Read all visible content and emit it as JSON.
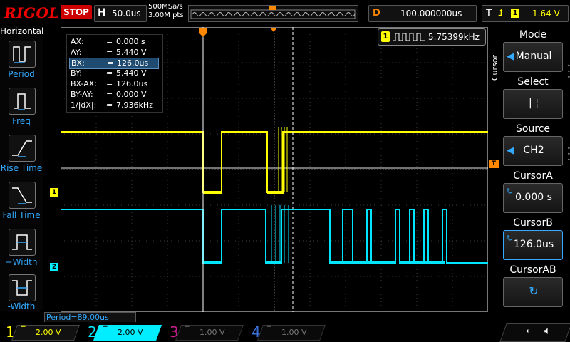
{
  "top": {
    "brand": "RIGOL",
    "run_state": "STOP",
    "h_key": "H",
    "h_value": "50.0us",
    "sample_rate": "500MSa/s",
    "mem_depth": "3.00M pts",
    "d_key": "D",
    "d_value": "100.000000us",
    "t_key": "T",
    "trig_channel": "1",
    "trig_level": "1.64 V"
  },
  "left_menu": {
    "title": "Horizontal",
    "items": [
      {
        "label": "Period"
      },
      {
        "label": "Freq"
      },
      {
        "label": "Rise Time"
      },
      {
        "label": "Fall Time"
      },
      {
        "label": "+Width"
      },
      {
        "label": "-Width"
      }
    ]
  },
  "cursor_table": {
    "rows": [
      {
        "name": "AX:",
        "eq": "=",
        "value": "0.000 s"
      },
      {
        "name": "AY:",
        "eq": "=",
        "value": "5.440 V"
      },
      {
        "name": "BX:",
        "eq": "=",
        "value": "126.0us"
      },
      {
        "name": "BY:",
        "eq": "=",
        "value": "5.440 V"
      },
      {
        "name": "BX-AX:",
        "eq": "=",
        "value": "126.0us"
      },
      {
        "name": "BY-AY:",
        "eq": "=",
        "value": "0.000 V"
      },
      {
        "name": "1/|dX|:",
        "eq": "=",
        "value": "7.936kHz"
      }
    ]
  },
  "freq_box": {
    "channel": "1",
    "value": "5.75399kHz"
  },
  "markers": {
    "ch1": "1",
    "ch2": "2",
    "trig": "T"
  },
  "right_menu": {
    "tab": "Cursor",
    "items": [
      {
        "head": "Mode",
        "value": "Manual"
      },
      {
        "head": "Select",
        "value": "|     ¦"
      },
      {
        "head": "Source",
        "value": "CH2"
      },
      {
        "head": "CursorA",
        "value": "0.000 s"
      },
      {
        "head": "CursorB",
        "value": "126.0us"
      },
      {
        "head": "CursorAB",
        "value": ""
      }
    ]
  },
  "period_readout": "Period=89.00us",
  "channels": [
    {
      "num": "1",
      "value": "2.00 V",
      "color": "#ffff00",
      "active": true
    },
    {
      "num": "2",
      "value": "2.00 V",
      "color": "#00e5ff",
      "active": true
    },
    {
      "num": "3",
      "value": "1.00 V",
      "color": "#c81e8c",
      "active": false
    },
    {
      "num": "4",
      "value": "1.00 V",
      "color": "#3a6fd8",
      "active": false
    }
  ],
  "colors": {
    "ch1": "#ffff00",
    "ch2": "#00e5ff",
    "accent": "#33aaff",
    "trigger": "#ff8800",
    "stop": "#cc0000"
  }
}
